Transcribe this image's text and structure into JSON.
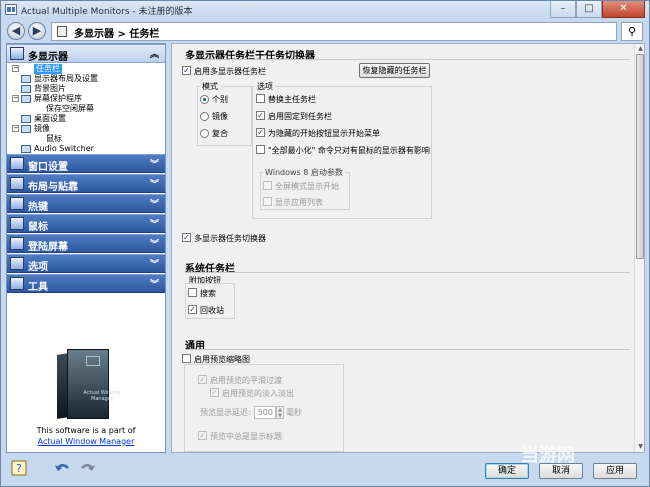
{
  "window": {
    "title": "Actual Multiple Monitors - 未注册的版本",
    "controls": {
      "minimize": "–",
      "maximize": "□",
      "close": "✕"
    }
  },
  "nav": {
    "breadcrumb": "多显示器 > 任务栏",
    "back_icon": "back-arrow-icon",
    "forward_icon": "forward-arrow-icon",
    "search_icon": "magnifier-icon"
  },
  "sidebar": {
    "sections": [
      {
        "label": "多显示器",
        "icon": "monitors-icon",
        "expanded": true
      },
      {
        "label": "窗口设置",
        "icon": "window-icon",
        "expanded": false
      },
      {
        "label": "布局与贴靠",
        "icon": "layout-icon",
        "expanded": false
      },
      {
        "label": "热键",
        "icon": "keyboard-icon",
        "expanded": false
      },
      {
        "label": "鼠标",
        "icon": "mouse-icon",
        "expanded": false
      },
      {
        "label": "登陆屏幕",
        "icon": "key-icon",
        "expanded": false
      },
      {
        "label": "选项",
        "icon": "options-icon",
        "expanded": false
      },
      {
        "label": "工具",
        "icon": "tools-icon",
        "expanded": false
      }
    ],
    "tree": [
      {
        "label": "任务栏",
        "selected": true
      },
      {
        "label": "显示器布局及设置",
        "selected": false
      },
      {
        "label": "背景图片",
        "selected": false
      },
      {
        "label": "屏幕保护程序",
        "selected": false
      },
      {
        "label": "保存空闲屏幕",
        "selected": false
      },
      {
        "label": "桌面设置",
        "selected": false
      },
      {
        "label": "镜像",
        "selected": false
      },
      {
        "label": "鼠标",
        "selected": false
      },
      {
        "label": "Audio Switcher",
        "selected": false
      }
    ],
    "promo": {
      "box_title": "Actual Window Manager",
      "text": "This software is a part of",
      "link": "Actual Window Manager"
    }
  },
  "main": {
    "section1": {
      "title": "多显示器任务栏于任务切换器",
      "enable_taskbar": {
        "label": "启用多显示器任务栏",
        "checked": true
      },
      "restore_button": "恢复隐藏的任务栏",
      "mode_group": {
        "title": "模式",
        "options": [
          {
            "label": "个别",
            "selected": true
          },
          {
            "label": "镜像",
            "selected": false
          },
          {
            "label": "复合",
            "selected": false
          }
        ]
      },
      "options_group": {
        "title": "选项",
        "items": [
          {
            "label": "替换主任务栏",
            "checked": false
          },
          {
            "label": "启用固定到任务栏",
            "checked": true
          },
          {
            "label": "为隐藏的开始按钮显示开始菜单",
            "checked": true
          },
          {
            "label": "\"全部最小化\" 命令只对有鼠标的显示器有影响",
            "checked": false
          }
        ]
      },
      "win8_group": {
        "title": "Windows 8 启动参数",
        "items": [
          {
            "label": "全屏模式显示开始",
            "checked": false
          },
          {
            "label": "显示应用列表",
            "checked": false
          }
        ]
      },
      "task_switcher": {
        "label": "多显示器任务切换器",
        "checked": true
      }
    },
    "section2": {
      "title": "系统任务栏",
      "group_title": "附加按钮",
      "items": [
        {
          "label": "搜索",
          "checked": false
        },
        {
          "label": "回收站",
          "checked": true
        }
      ]
    },
    "section3": {
      "title": "通用",
      "enable_preview": {
        "label": "启用预览缩略图",
        "checked": false
      },
      "items": [
        {
          "label": "启用预览的平滑过渡",
          "checked": true
        },
        {
          "label": "启用预览的淡入淡出",
          "checked": true
        },
        {
          "label": "预览中总是显示标题",
          "checked": true
        }
      ],
      "delay": {
        "label": "预览显示延迟:",
        "value": "500",
        "unit": "毫秒"
      }
    }
  },
  "footer": {
    "ok": "确定",
    "cancel": "取消",
    "apply": "应用",
    "help_icon": "help-icon",
    "undo_icon": "undo-icon",
    "redo_icon": "redo-icon"
  },
  "watermark": "当游网"
}
